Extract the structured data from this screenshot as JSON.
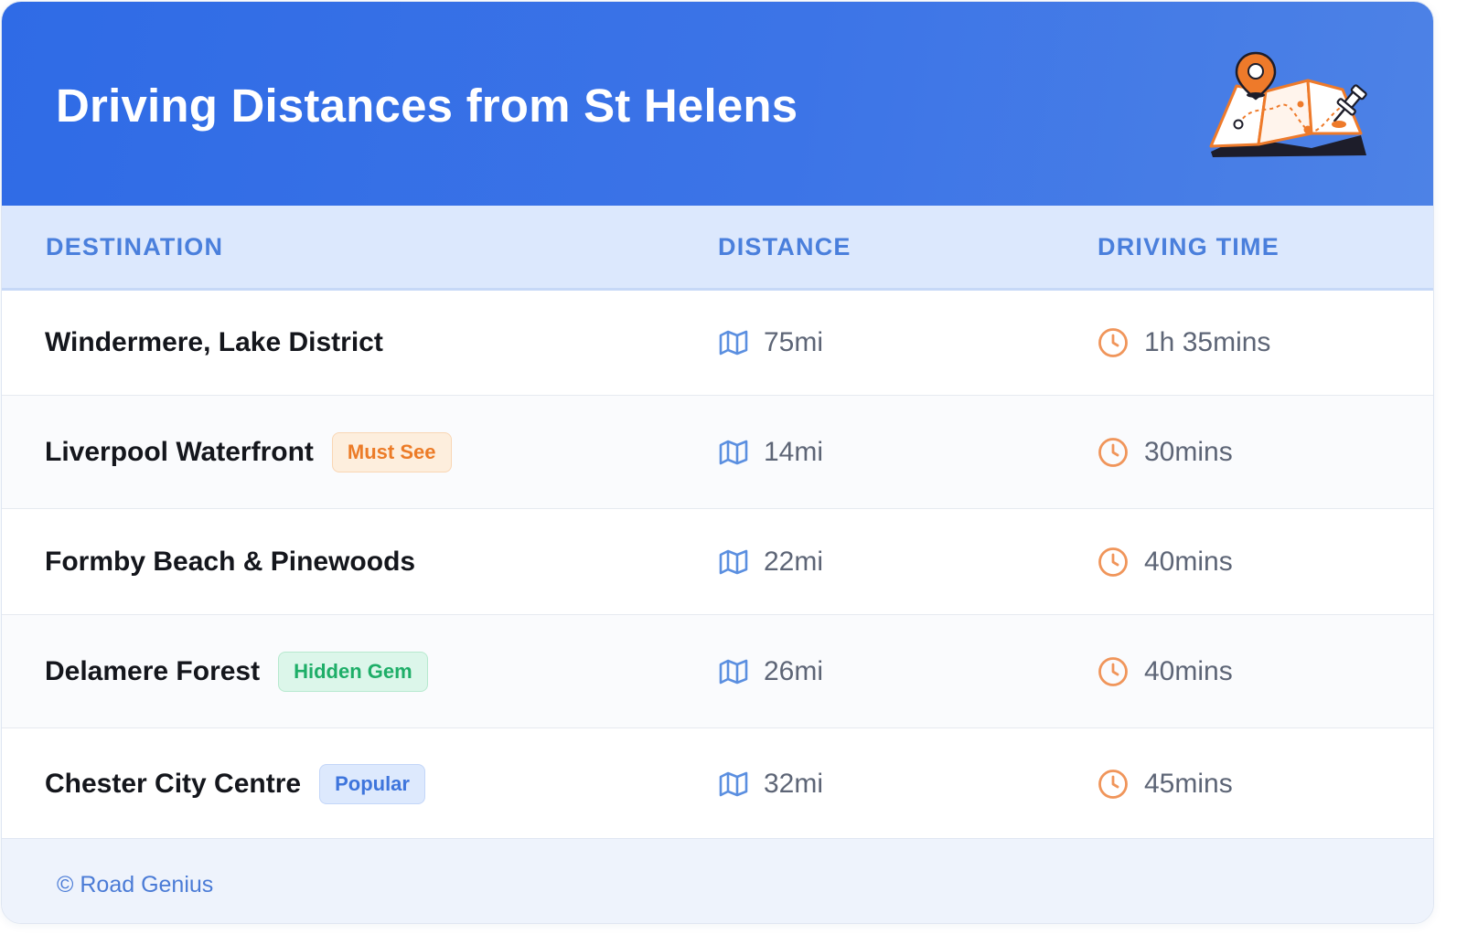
{
  "header": {
    "title": "Driving Distances from St Helens",
    "illustration_icon": "map-with-pins-icon"
  },
  "columns": {
    "destination": "DESTINATION",
    "distance": "DISTANCE",
    "driving_time": "DRIVING TIME"
  },
  "rows": [
    {
      "destination": "Windermere, Lake District",
      "badge": "",
      "distance": "75mi",
      "time": "1h 35mins"
    },
    {
      "destination": "Liverpool Waterfront",
      "badge": "Must See",
      "distance": "14mi",
      "time": "30mins"
    },
    {
      "destination": "Formby Beach & Pinewoods",
      "badge": "",
      "distance": "22mi",
      "time": "40mins"
    },
    {
      "destination": "Delamere Forest",
      "badge": "Hidden Gem",
      "distance": "26mi",
      "time": "40mins"
    },
    {
      "destination": "Chester City Centre",
      "badge": "Popular",
      "distance": "32mi",
      "time": "45mins"
    }
  ],
  "icons": {
    "distance": "map-icon",
    "time": "clock-icon"
  },
  "footer": {
    "credit": "© Road Genius"
  },
  "colors": {
    "header_gradient_start": "#2f6be6",
    "header_gradient_end": "#4d82e6",
    "column_header_text": "#4a7fdc",
    "map_icon": "#5b8fe0",
    "clock_icon": "#f0955a",
    "badge_must_see": "#ec7b27",
    "badge_hidden_gem": "#1eae68",
    "badge_popular": "#3e75dc"
  }
}
